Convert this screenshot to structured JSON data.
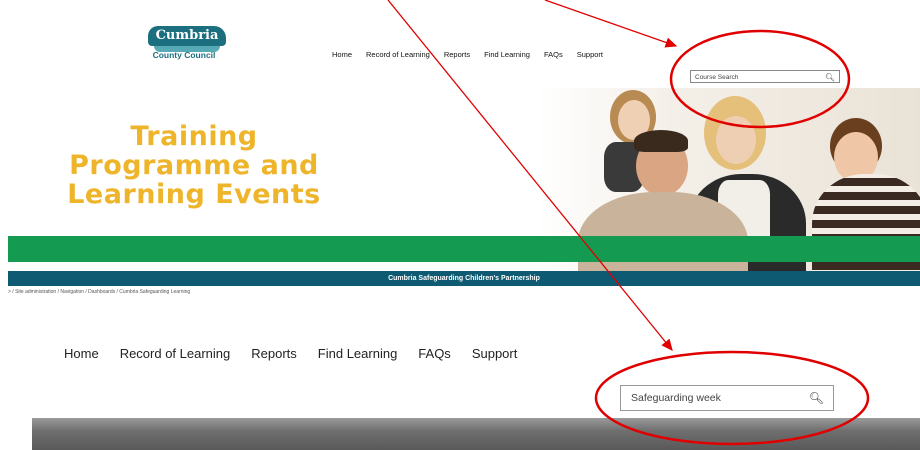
{
  "top": {
    "logo": {
      "name": "Cumbria",
      "sub": "County Council"
    },
    "nav": [
      "Home",
      "Record of Learning",
      "Reports",
      "Find Learning",
      "FAQs",
      "Support"
    ],
    "search_placeholder": "Course Search",
    "hero_title": [
      "Training",
      "Programme and",
      "Learning Events"
    ],
    "banner_text": "Cumbria Safeguarding Children's Partnership",
    "breadcrumb": "> / Site administration / Navigation / Dashboards / Cumbria Safeguarding Learning"
  },
  "bottom": {
    "nav": [
      "Home",
      "Record of Learning",
      "Reports",
      "Find Learning",
      "FAQs",
      "Support"
    ],
    "search_value": "Safeguarding week"
  },
  "colors": {
    "hero_title": "#eeb52b",
    "green_bar": "#159a52",
    "teal_bar": "#0e5a73",
    "annotation": "#e00000"
  }
}
